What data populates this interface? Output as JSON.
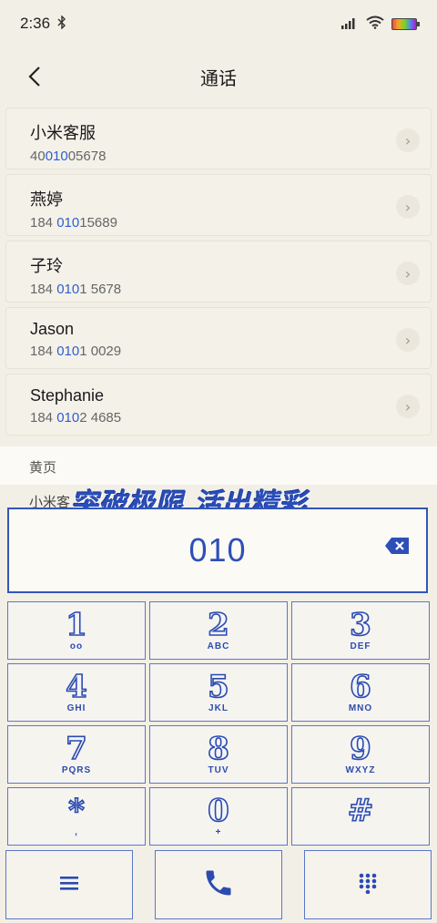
{
  "status": {
    "time": "2:36"
  },
  "header": {
    "title": "通话"
  },
  "contacts": [
    {
      "name": "小米客服",
      "num_pre": "40",
      "num_hl": "010",
      "num_post": "05678"
    },
    {
      "name": "燕婷",
      "num_pre": "184 ",
      "num_hl": "010",
      "num_post": "15689"
    },
    {
      "name": "子玲",
      "num_pre": "184 ",
      "num_hl": "010",
      "num_post": "1 5678"
    },
    {
      "name": "Jason",
      "num_pre": "184 ",
      "num_hl": "010",
      "num_post": "1 0029"
    },
    {
      "name": "Stephanie",
      "num_pre": "184 ",
      "num_hl": "010",
      "num_post": "2 4685"
    }
  ],
  "yellow_pages": {
    "label": "黄页",
    "peek": "小米客"
  },
  "banner": {
    "text": "突破极限  活出精彩"
  },
  "dialer": {
    "input": "010",
    "keys": [
      {
        "digit": "1",
        "letters": "oo"
      },
      {
        "digit": "2",
        "letters": "ABC"
      },
      {
        "digit": "3",
        "letters": "DEF"
      },
      {
        "digit": "4",
        "letters": "GHI"
      },
      {
        "digit": "5",
        "letters": "JKL"
      },
      {
        "digit": "6",
        "letters": "MNO"
      },
      {
        "digit": "7",
        "letters": "PQRS"
      },
      {
        "digit": "8",
        "letters": "TUV"
      },
      {
        "digit": "9",
        "letters": "WXYZ"
      },
      {
        "digit": "*",
        "letters": ","
      },
      {
        "digit": "0",
        "letters": "+"
      },
      {
        "digit": "#",
        "letters": ""
      }
    ]
  },
  "colors": {
    "accent": "#2e5fd1",
    "keypad_stroke": "#2b4bb0",
    "background": "#f2efe6"
  },
  "icons": {
    "menu": "menu-icon",
    "call": "phone-icon",
    "keypad": "keypad-grid-icon",
    "delete": "backspace-icon",
    "back": "chevron-left-icon"
  }
}
